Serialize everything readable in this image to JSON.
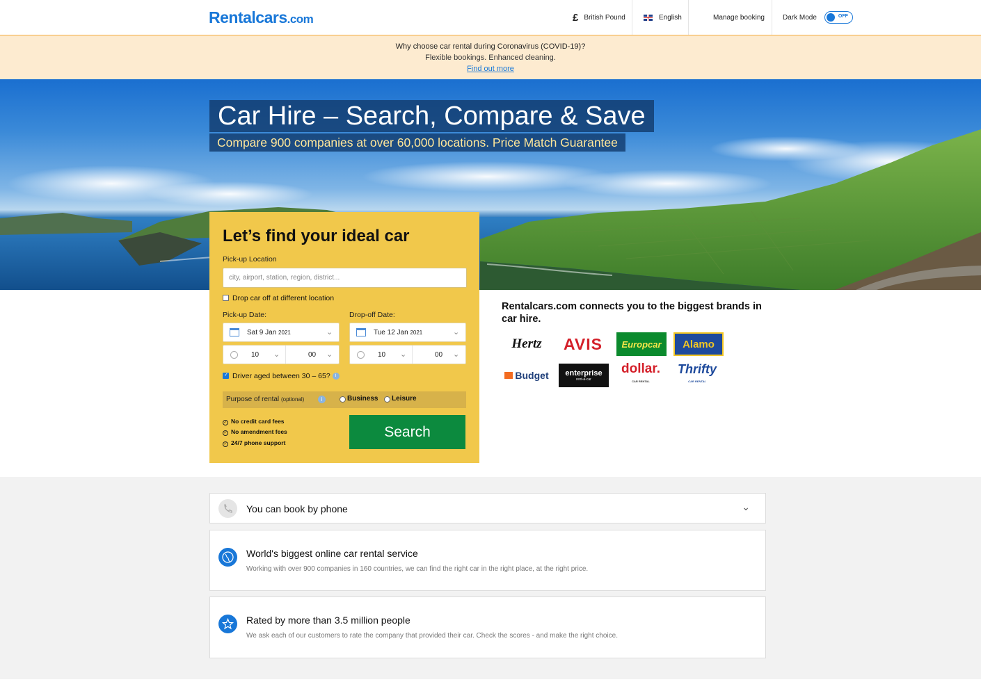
{
  "header": {
    "logo_main": "Rentalcars",
    "logo_suffix": ".com",
    "currency_symbol": "£",
    "currency": "British Pound",
    "language": "English",
    "manage_booking": "Manage booking",
    "dark_mode_label": "Dark Mode",
    "dark_mode_state": "OFF"
  },
  "covid_banner": {
    "question": "Why choose car rental during Coronavirus (COVID-19)?",
    "subtitle": "Flexible bookings. Enhanced cleaning.",
    "link": "Find out more"
  },
  "hero": {
    "title": "Car Hire – Search, Compare & Save",
    "subtitle": "Compare 900 companies at over 60,000 locations. Price Match Guarantee"
  },
  "search_form": {
    "heading": "Let’s find your ideal car",
    "pickup_location_label": "Pick-up Location",
    "pickup_location_placeholder": "city, airport, station, region, district...",
    "drop_off_different_label": "Drop car off at different location",
    "drop_off_different_checked": false,
    "pickup_date_label": "Pick-up Date:",
    "pickup_date_value": "Sat 9 Jan",
    "pickup_date_year": "2021",
    "pickup_hour": "10",
    "pickup_minute": "00",
    "dropoff_date_label": "Drop-off Date:",
    "dropoff_date_value": "Tue 12 Jan",
    "dropoff_date_year": "2021",
    "dropoff_hour": "10",
    "dropoff_minute": "00",
    "driver_age_label": "Driver aged between 30 – 65?",
    "driver_age_checked": true,
    "purpose_label": "Purpose of rental",
    "purpose_optional": "(optional)",
    "purpose_options": [
      "Business",
      "Leisure"
    ],
    "benefits": [
      "No credit card fees",
      "No amendment fees",
      "24/7 phone support"
    ],
    "search_button": "Search"
  },
  "brands": {
    "title": "Rentalcars.com connects you to the biggest brands in car hire.",
    "items": [
      "Hertz",
      "AVIS",
      "Europcar",
      "Alamo",
      "Budget",
      "enterprise",
      "dollar.",
      "Thrifty"
    ],
    "sub_labels": {
      "dollar": "CAR RENTAL",
      "thrifty": "CAR RENTAL",
      "enterprise": "rent-a-car"
    }
  },
  "features": [
    {
      "title": "You can book by phone",
      "description": ""
    },
    {
      "title": "World's biggest online car rental service",
      "description": "Working with over 900 companies in 160 countries, we can find the right car in the right place, at the right price."
    },
    {
      "title": "Rated by more than 3.5 million people",
      "description": "We ask each of our customers to rate the company that provided their car. Check the scores - and make the right choice."
    }
  ],
  "colors": {
    "brand_blue": "#1877d8",
    "form_yellow": "#f1c84b",
    "search_green": "#0c8a3e",
    "banner_peach": "#fdebd0"
  }
}
